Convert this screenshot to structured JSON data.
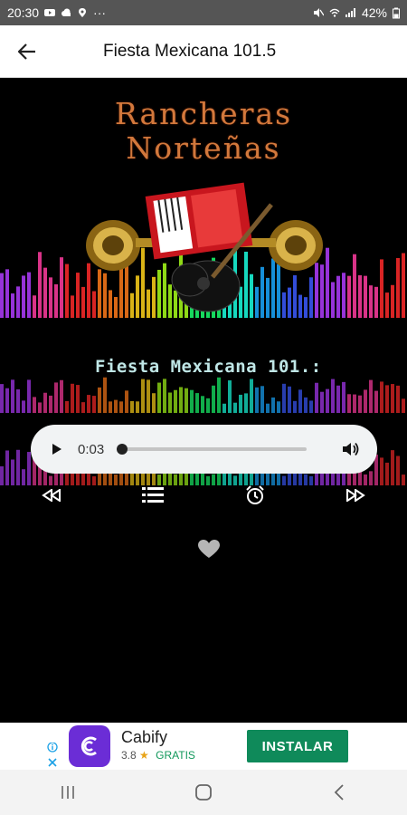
{
  "status": {
    "time": "20:30",
    "dots": "···",
    "battery": "42%"
  },
  "appbar": {
    "title": "Fiesta Mexicana 101.5"
  },
  "logo": {
    "line1": "Rancheras",
    "line2": "Norteñas"
  },
  "station": {
    "display_text": "Fiesta Mexicana 101.:"
  },
  "player": {
    "current_time": "0:03",
    "progress": 0.0
  },
  "ad": {
    "name": "Cabify",
    "rating": "3.8",
    "star": "★",
    "price": "GRATIS",
    "cta": "INSTALAR"
  },
  "colors": {
    "accent_green": "#0f8a5a",
    "ad_brand": "#6b2dd6",
    "logo_text": "#d2783c"
  },
  "icons": [
    "back-arrow-icon",
    "play-icon",
    "volume-icon",
    "rewind-icon",
    "playlist-icon",
    "alarm-icon",
    "fast-forward-icon",
    "heart-icon",
    "recent-apps-icon",
    "home-icon",
    "back-icon"
  ]
}
